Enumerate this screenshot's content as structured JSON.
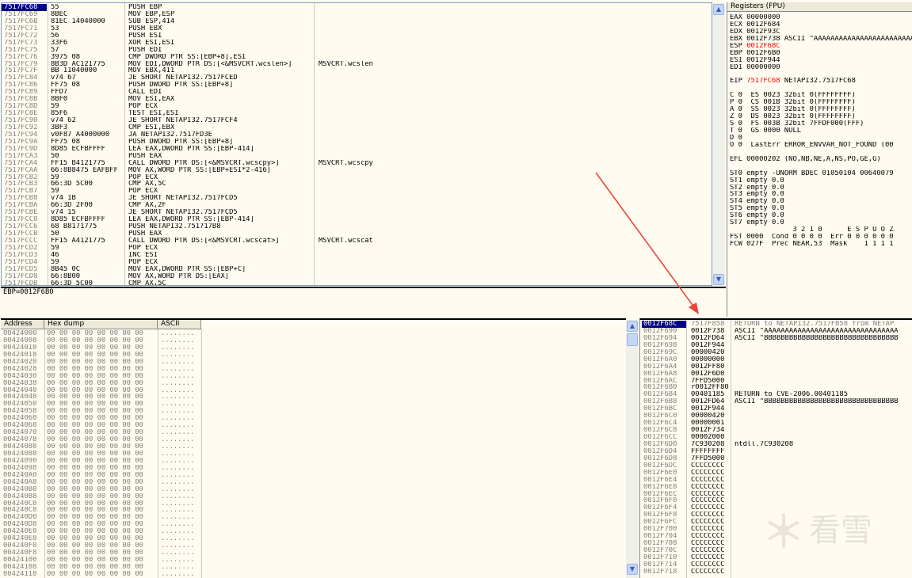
{
  "disasm": {
    "rows": [
      {
        "addr": "7517FC68",
        "hex": "55",
        "ins": "PUSH EBP",
        "cmt": "",
        "selected": true
      },
      {
        "addr": "7517FC69",
        "hex": "8BEC",
        "ins": "MOV EBP,ESP",
        "cmt": ""
      },
      {
        "addr": "7517FC6B",
        "hex": "81EC 14040000",
        "ins": "SUB ESP,414",
        "cmt": ""
      },
      {
        "addr": "7517FC71",
        "hex": "53",
        "ins": "PUSH EBX",
        "cmt": ""
      },
      {
        "addr": "7517FC72",
        "hex": "56",
        "ins": "PUSH ESI",
        "cmt": ""
      },
      {
        "addr": "7517FC73",
        "hex": "33F6",
        "ins": "XOR ESI,ESI",
        "cmt": ""
      },
      {
        "addr": "7517FC75",
        "hex": "57",
        "ins": "PUSH EDI",
        "cmt": ""
      },
      {
        "addr": "7517FC76",
        "hex": "3975 08",
        "ins": "CMP DWORD PTR SS:[EBP+8],ESI",
        "cmt": ""
      },
      {
        "addr": "7517FC79",
        "hex": "8B3D AC121775",
        "ins": "MOV EDI,DWORD PTR DS:[<&MSVCRT.wcslen>]",
        "cmt": "MSVCRT.wcslen"
      },
      {
        "addr": "7517FC7F",
        "hex": "BB 11040000",
        "ins": "MOV EBX,411",
        "cmt": ""
      },
      {
        "addr": "7517FC84",
        "hex": "v74 67",
        "ins": "JE SHORT NETAPI32.7517FCED",
        "cmt": ""
      },
      {
        "addr": "7517FC86",
        "hex": "FF75 08",
        "ins": "PUSH DWORD PTR SS:[EBP+8]",
        "cmt": ""
      },
      {
        "addr": "7517FC89",
        "hex": "FFD7",
        "ins": "CALL EDI",
        "cmt": ""
      },
      {
        "addr": "7517FC8B",
        "hex": "8BF0",
        "ins": "MOV ESI,EAX",
        "cmt": ""
      },
      {
        "addr": "7517FC8D",
        "hex": "59",
        "ins": "POP ECX",
        "cmt": ""
      },
      {
        "addr": "7517FC8E",
        "hex": "85F6",
        "ins": "TEST ESI,ESI",
        "cmt": ""
      },
      {
        "addr": "7517FC90",
        "hex": "v74 62",
        "ins": "JE SHORT NETAPI32.7517FCF4",
        "cmt": ""
      },
      {
        "addr": "7517FC92",
        "hex": "3BF3",
        "ins": "CMP ESI,EBX",
        "cmt": ""
      },
      {
        "addr": "7517FC94",
        "hex": "v0F87 A4000000",
        "ins": "JA NETAPI32.7517FD3E",
        "cmt": ""
      },
      {
        "addr": "7517FC9A",
        "hex": "FF75 08",
        "ins": "PUSH DWORD PTR SS:[EBP+8]",
        "cmt": ""
      },
      {
        "addr": "7517FC9D",
        "hex": "8D85 ECFBFFFF",
        "ins": "LEA EAX,DWORD PTR SS:[EBP-414]",
        "cmt": ""
      },
      {
        "addr": "7517FCA3",
        "hex": "50",
        "ins": "PUSH EAX",
        "cmt": ""
      },
      {
        "addr": "7517FCA4",
        "hex": "FF15 B4121775",
        "ins": "CALL DWORD PTR DS:[<&MSVCRT.wcscpy>]",
        "cmt": "MSVCRT.wcscpy"
      },
      {
        "addr": "7517FCAA",
        "hex": "66:8B8475 EAFBFF",
        "ins": "MOV AX,WORD PTR SS:[EBP+ESI*2-416]",
        "cmt": ""
      },
      {
        "addr": "7517FCB2",
        "hex": "59",
        "ins": "POP ECX",
        "cmt": ""
      },
      {
        "addr": "7517FCB3",
        "hex": "66:3D 5C00",
        "ins": "CMP AX,5C",
        "cmt": ""
      },
      {
        "addr": "7517FCB7",
        "hex": "59",
        "ins": "POP ECX",
        "cmt": ""
      },
      {
        "addr": "7517FCB8",
        "hex": "v74 1B",
        "ins": "JE SHORT NETAPI32.7517FCD5",
        "cmt": ""
      },
      {
        "addr": "7517FCBA",
        "hex": "66:3D 2F00",
        "ins": "CMP AX,2F",
        "cmt": ""
      },
      {
        "addr": "7517FCBE",
        "hex": "v74 15",
        "ins": "JE SHORT NETAPI32.7517FCD5",
        "cmt": ""
      },
      {
        "addr": "7517FCC0",
        "hex": "8D85 ECFBFFFF",
        "ins": "LEA EAX,DWORD PTR SS:[EBP-414]",
        "cmt": ""
      },
      {
        "addr": "7517FCC6",
        "hex": "68 B8171775",
        "ins": "PUSH NETAPI32.751717B8",
        "cmt": ""
      },
      {
        "addr": "7517FCCB",
        "hex": "50",
        "ins": "PUSH EAX",
        "cmt": ""
      },
      {
        "addr": "7517FCCC",
        "hex": "FF15 A4121775",
        "ins": "CALL DWORD PTR DS:[<&MSVCRT.wcscat>]",
        "cmt": "MSVCRT.wcscat"
      },
      {
        "addr": "7517FCD2",
        "hex": "59",
        "ins": "POP ECX",
        "cmt": ""
      },
      {
        "addr": "7517FCD3",
        "hex": "46",
        "ins": "INC ESI",
        "cmt": ""
      },
      {
        "addr": "7517FCD4",
        "hex": "59",
        "ins": "POP ECX",
        "cmt": ""
      },
      {
        "addr": "7517FCD5",
        "hex": "8B45 0C",
        "ins": "MOV EAX,DWORD PTR SS:[EBP+C]",
        "cmt": ""
      },
      {
        "addr": "7517FCD8",
        "hex": "66:8B00",
        "ins": "MOV AX,WORD PTR DS:[EAX]",
        "cmt": ""
      },
      {
        "addr": "7517FCDB",
        "hex": "66:3D 5C00",
        "ins": "CMP AX,5C",
        "cmt": ""
      }
    ]
  },
  "info": {
    "text": "EBP=0012F6B0"
  },
  "registers": {
    "title": "Registers (FPU)",
    "lines": [
      {
        "t": "EAX 00000000"
      },
      {
        "t": "ECX 0012F684"
      },
      {
        "t": "EDX 0012F93C"
      },
      {
        "t": "EBX 0012F738 ASCII \"AAAAAAAAAAAAAAAAAAAAAAAAA"
      },
      {
        "t": "ESP ",
        "r": "0012F68C"
      },
      {
        "t": "EBP 0012F6B0"
      },
      {
        "t": "ESI 0012F944"
      },
      {
        "t": "EDI 00000000"
      },
      {
        "t": ""
      },
      {
        "t": "EIP ",
        "r": "7517FC68",
        "s": " NETAPI32.7517FC68"
      },
      {
        "t": ""
      },
      {
        "t": "C 0  ES 0023 32bit 0(FFFFFFFF)"
      },
      {
        "t": "P 0  CS 001B 32bit 0(FFFFFFFF)"
      },
      {
        "t": "A 0  SS 0023 32bit 0(FFFFFFFF)"
      },
      {
        "t": "Z 0  DS 0023 32bit 0(FFFFFFFF)"
      },
      {
        "t": "S 0  FS 003B 32bit 7FFDF000(FFF)"
      },
      {
        "t": "T 0  GS 0000 NULL"
      },
      {
        "t": "D 0"
      },
      {
        "t": "O 0  LastErr ERROR_ENVVAR_NOT_FOUND (00"
      },
      {
        "t": ""
      },
      {
        "t": "EFL 00000202 (NO,NB,NE,A,NS,PO,GE,G)"
      },
      {
        "t": ""
      },
      {
        "t": "ST0 empty -UNORM BDEC 01050104 00640079"
      },
      {
        "t": "ST1 empty 0.0"
      },
      {
        "t": "ST2 empty 0.0"
      },
      {
        "t": "ST3 empty 0.0"
      },
      {
        "t": "ST4 empty 0.0"
      },
      {
        "t": "ST5 empty 0.0"
      },
      {
        "t": "ST6 empty 0.0"
      },
      {
        "t": "ST7 empty 0.0"
      },
      {
        "t": "               3 2 1 0      E S P U O Z"
      },
      {
        "t": "FST 0000  Cond 0 0 0 0  Err 0 0 0 0 0 0"
      },
      {
        "t": "FCW 027F  Prec NEAR,53  Mask    1 1 1 1"
      }
    ]
  },
  "dump": {
    "headers": {
      "address": "Address",
      "hex": "Hex dump",
      "ascii": "ASCII"
    },
    "hex_value": "00 00 00 00 00 00 00 00",
    "ascii_value": "........",
    "addresses": [
      "00424000",
      "00424008",
      "00424010",
      "00424018",
      "00424020",
      "00424028",
      "00424030",
      "00424038",
      "00424040",
      "00424048",
      "00424050",
      "00424058",
      "00424060",
      "00424068",
      "00424070",
      "00424078",
      "00424080",
      "00424088",
      "00424090",
      "00424098",
      "004240A0",
      "004240A8",
      "004240B0",
      "004240B8",
      "004240C0",
      "004240C8",
      "004240D0",
      "004240D8",
      "004240E0",
      "004240E8",
      "004240F0",
      "004240F8",
      "00424100",
      "00424108",
      "00424110"
    ]
  },
  "stack": {
    "rows": [
      {
        "a": "0012F68C",
        "v": "7517F858",
        "c": "RETURN to NETAPI32.7517F858 from NETAP",
        "sel": true
      },
      {
        "a": "0012F690",
        "v": "0012F738",
        "c": "ASCII \"AAAAAAAAAAAAAAAAAAAAAAAAAAAAAAAA"
      },
      {
        "a": "0012F694",
        "v": "0012FD64",
        "c": "ASCII \"BBBBBBBBBBBBBBBBBBBBBBBBBBBBBBBB"
      },
      {
        "a": "0012F698",
        "v": "0012F944",
        "c": ""
      },
      {
        "a": "0012F69C",
        "v": "00000420",
        "c": ""
      },
      {
        "a": "0012F6A0",
        "v": "00000000",
        "c": ""
      },
      {
        "a": "0012F6A4",
        "v": "0012FF80",
        "c": ""
      },
      {
        "a": "0012F6A8",
        "v": "0012F6D0",
        "c": ""
      },
      {
        "a": "0012F6AC",
        "v": "7FFD5000",
        "c": ""
      },
      {
        "a": "0012F6B0",
        "v": "r0012FF80",
        "c": ""
      },
      {
        "a": "0012F6B4",
        "v": "00401185",
        "c": "RETURN to CVE-2006.00401185"
      },
      {
        "a": "0012F6B8",
        "v": "0012FD64",
        "c": "ASCII \"BBBBBBBBBBBBBBBBBBBBBBBBBBBBBBBB"
      },
      {
        "a": "0012F6BC",
        "v": "0012F944",
        "c": ""
      },
      {
        "a": "0012F6C0",
        "v": "00000420",
        "c": ""
      },
      {
        "a": "0012F6C4",
        "v": "00000001",
        "c": ""
      },
      {
        "a": "0012F6C8",
        "v": "0012F734",
        "c": ""
      },
      {
        "a": "0012F6CC",
        "v": "00002000",
        "c": ""
      },
      {
        "a": "0012F6D0",
        "v": "7C930208",
        "c": "ntdll.7C930208"
      },
      {
        "a": "0012F6D4",
        "v": "FFFFFFFF",
        "c": ""
      },
      {
        "a": "0012F6D8",
        "v": "7FFD5000",
        "c": ""
      },
      {
        "a": "0012F6DC",
        "v": "CCCCCCCC",
        "c": ""
      },
      {
        "a": "0012F6E0",
        "v": "CCCCCCCC",
        "c": ""
      },
      {
        "a": "0012F6E4",
        "v": "CCCCCCCC",
        "c": ""
      },
      {
        "a": "0012F6E8",
        "v": "CCCCCCCC",
        "c": ""
      },
      {
        "a": "0012F6EC",
        "v": "CCCCCCCC",
        "c": ""
      },
      {
        "a": "0012F6F0",
        "v": "CCCCCCCC",
        "c": ""
      },
      {
        "a": "0012F6F4",
        "v": "CCCCCCCC",
        "c": ""
      },
      {
        "a": "0012F6F8",
        "v": "CCCCCCCC",
        "c": ""
      },
      {
        "a": "0012F6FC",
        "v": "CCCCCCCC",
        "c": ""
      },
      {
        "a": "0012F700",
        "v": "CCCCCCCC",
        "c": ""
      },
      {
        "a": "0012F704",
        "v": "CCCCCCCC",
        "c": ""
      },
      {
        "a": "0012F708",
        "v": "CCCCCCCC",
        "c": ""
      },
      {
        "a": "0012F70C",
        "v": "CCCCCCCC",
        "c": ""
      },
      {
        "a": "0012F710",
        "v": "CCCCCCCC",
        "c": ""
      },
      {
        "a": "0012F714",
        "v": "CCCCCCCC",
        "c": ""
      },
      {
        "a": "0012F718",
        "v": "CCCCCCCC",
        "c": ""
      }
    ]
  },
  "watermark": {
    "text": "看雪",
    "icon": "snowflake-icon"
  },
  "annotation": {
    "icon": "red-arrow-icon",
    "color": "#e8463c"
  },
  "scroll_icons": {
    "up": "▲",
    "down": "▼"
  }
}
